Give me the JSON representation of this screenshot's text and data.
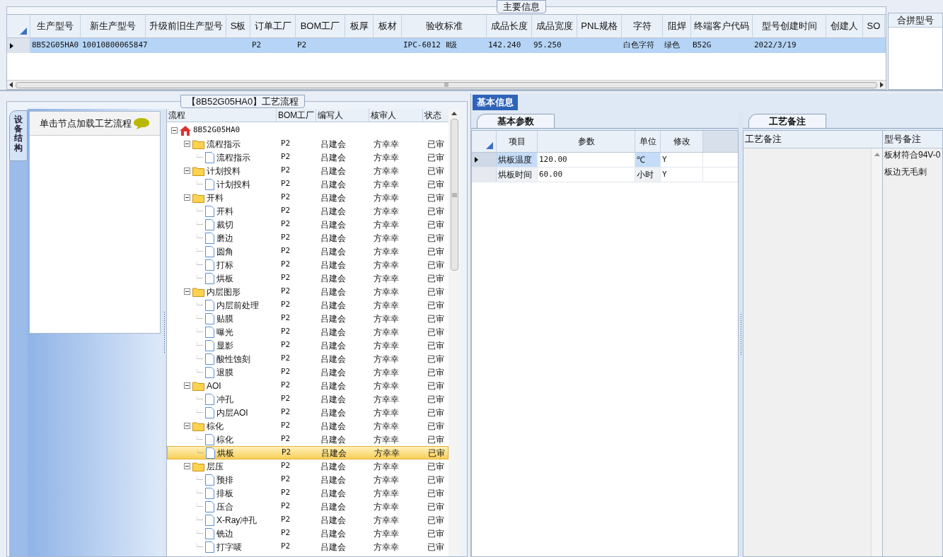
{
  "main_info": {
    "title": "主要信息",
    "columns": [
      "生产型号",
      "新生产型号",
      "升级前旧生产型号",
      "S板",
      "订单工厂",
      "BOM工厂",
      "板厚",
      "板材",
      "验收标准",
      "成品长度",
      "成品宽度",
      "PNL规格",
      "字符",
      "阻焊",
      "终端客户代码",
      "型号创建时间",
      "创建人",
      "SO"
    ],
    "rows": [
      {
        "selected": true,
        "cells": [
          "8B52G05HA0",
          "10010800065847",
          "",
          "",
          "P2",
          "P2",
          "",
          "",
          "IPC-6012 Ⅱ级",
          "142.240",
          "95.250",
          "",
          "白色字符",
          "绿色",
          "B52G",
          "2022/3/19",
          "",
          ""
        ]
      }
    ]
  },
  "merge_panel": {
    "title": "合拼型号"
  },
  "flow": {
    "title": "【8B52G05HA0】工艺流程",
    "side_tab": "设备结构",
    "hint": "单击节点加载工艺流程",
    "columns": [
      "流程",
      "BOM工厂",
      "编写人",
      "核审人",
      "状态"
    ],
    "tree": [
      {
        "label": "8B52G05HA0",
        "kind": "home",
        "expanded": true,
        "selected": false,
        "children": [
          {
            "label": "流程指示",
            "kind": "folder",
            "expanded": true,
            "selected": false,
            "cells": [
              "P2",
              "吕建会",
              "方幸幸",
              "已审"
            ],
            "children": [
              {
                "label": "流程指示",
                "kind": "step",
                "selected": false,
                "cells": [
                  "P2",
                  "吕建会",
                  "方幸幸",
                  "已审"
                ]
              }
            ]
          },
          {
            "label": "计划投料",
            "kind": "folder",
            "expanded": true,
            "selected": false,
            "cells": [
              "P2",
              "吕建会",
              "方幸幸",
              "已审"
            ],
            "children": [
              {
                "label": "计划投料",
                "kind": "step",
                "selected": false,
                "cells": [
                  "P2",
                  "吕建会",
                  "方幸幸",
                  "已审"
                ]
              }
            ]
          },
          {
            "label": "开料",
            "kind": "folder",
            "expanded": true,
            "selected": false,
            "cells": [
              "P2",
              "吕建会",
              "方幸幸",
              "已审"
            ],
            "children": [
              {
                "label": "开料",
                "kind": "step",
                "selected": false,
                "cells": [
                  "P2",
                  "吕建会",
                  "方幸幸",
                  "已审"
                ]
              },
              {
                "label": "裁切",
                "kind": "step",
                "selected": false,
                "cells": [
                  "P2",
                  "吕建会",
                  "方幸幸",
                  "已审"
                ]
              },
              {
                "label": "磨边",
                "kind": "step",
                "selected": false,
                "cells": [
                  "P2",
                  "吕建会",
                  "方幸幸",
                  "已审"
                ]
              },
              {
                "label": "圆角",
                "kind": "step",
                "selected": false,
                "cells": [
                  "P2",
                  "吕建会",
                  "方幸幸",
                  "已审"
                ]
              },
              {
                "label": "打标",
                "kind": "step",
                "selected": false,
                "cells": [
                  "P2",
                  "吕建会",
                  "方幸幸",
                  "已审"
                ]
              },
              {
                "label": "烘板",
                "kind": "step",
                "selected": false,
                "cells": [
                  "P2",
                  "吕建会",
                  "方幸幸",
                  "已审"
                ]
              }
            ]
          },
          {
            "label": "内层图形",
            "kind": "folder",
            "expanded": true,
            "selected": false,
            "cells": [
              "P2",
              "吕建会",
              "方幸幸",
              "已审"
            ],
            "children": [
              {
                "label": "内层前处理",
                "kind": "step",
                "selected": false,
                "cells": [
                  "P2",
                  "吕建会",
                  "方幸幸",
                  "已审"
                ]
              },
              {
                "label": "贴膜",
                "kind": "step",
                "selected": false,
                "cells": [
                  "P2",
                  "吕建会",
                  "方幸幸",
                  "已审"
                ]
              },
              {
                "label": "曝光",
                "kind": "step",
                "selected": false,
                "cells": [
                  "P2",
                  "吕建会",
                  "方幸幸",
                  "已审"
                ]
              },
              {
                "label": "显影",
                "kind": "step",
                "selected": false,
                "cells": [
                  "P2",
                  "吕建会",
                  "方幸幸",
                  "已审"
                ]
              },
              {
                "label": "酸性蚀刻",
                "kind": "step",
                "selected": false,
                "cells": [
                  "P2",
                  "吕建会",
                  "方幸幸",
                  "已审"
                ]
              },
              {
                "label": "退膜",
                "kind": "step",
                "selected": false,
                "cells": [
                  "P2",
                  "吕建会",
                  "方幸幸",
                  "已审"
                ]
              }
            ]
          },
          {
            "label": "AOI",
            "kind": "folder",
            "expanded": true,
            "selected": false,
            "cells": [
              "P2",
              "吕建会",
              "方幸幸",
              "已审"
            ],
            "children": [
              {
                "label": "冲孔",
                "kind": "step",
                "selected": false,
                "cells": [
                  "P2",
                  "吕建会",
                  "方幸幸",
                  "已审"
                ]
              },
              {
                "label": "内层AOI",
                "kind": "step",
                "selected": false,
                "cells": [
                  "P2",
                  "吕建会",
                  "方幸幸",
                  "已审"
                ]
              }
            ]
          },
          {
            "label": "棕化",
            "kind": "folder",
            "expanded": true,
            "selected": false,
            "cells": [
              "P2",
              "吕建会",
              "方幸幸",
              "已审"
            ],
            "children": [
              {
                "label": "棕化",
                "kind": "step",
                "selected": false,
                "cells": [
                  "P2",
                  "吕建会",
                  "方幸幸",
                  "已审"
                ]
              },
              {
                "label": "烘板",
                "kind": "step",
                "selected": true,
                "cells": [
                  "P2",
                  "吕建会",
                  "方幸幸",
                  "已审"
                ]
              }
            ]
          },
          {
            "label": "层压",
            "kind": "folder",
            "expanded": true,
            "selected": false,
            "cells": [
              "P2",
              "吕建会",
              "方幸幸",
              "已审"
            ],
            "children": [
              {
                "label": "预排",
                "kind": "step",
                "selected": false,
                "cells": [
                  "P2",
                  "吕建会",
                  "方幸幸",
                  "已审"
                ]
              },
              {
                "label": "排板",
                "kind": "step",
                "selected": false,
                "cells": [
                  "P2",
                  "吕建会",
                  "方幸幸",
                  "已审"
                ]
              },
              {
                "label": "压合",
                "kind": "step",
                "selected": false,
                "cells": [
                  "P2",
                  "吕建会",
                  "方幸幸",
                  "已审"
                ]
              },
              {
                "label": "X-Ray冲孔",
                "kind": "step",
                "selected": false,
                "cells": [
                  "P2",
                  "吕建会",
                  "方幸幸",
                  "已审"
                ]
              },
              {
                "label": "铣边",
                "kind": "step",
                "selected": false,
                "cells": [
                  "P2",
                  "吕建会",
                  "方幸幸",
                  "已审"
                ]
              },
              {
                "label": "打字唛",
                "kind": "step",
                "selected": false,
                "cells": [
                  "P2",
                  "吕建会",
                  "方幸幸",
                  "已审"
                ]
              }
            ]
          }
        ]
      }
    ]
  },
  "basic": {
    "tab": "基本信息",
    "params": {
      "tab": "基本参数",
      "columns": [
        "项目",
        "参数",
        "单位",
        "修改"
      ],
      "rows": [
        {
          "selected": true,
          "cells": [
            "烘板温度",
            "120.00",
            "℃",
            "Y"
          ]
        },
        {
          "selected": false,
          "cells": [
            "烘板时间",
            "60.00",
            "小时",
            "Y"
          ]
        }
      ]
    },
    "notes": {
      "tab": "工艺备注",
      "columns": [
        "工艺备注",
        "型号备注"
      ],
      "model_notes": [
        "板材符合94V-0",
        "板边无毛刺"
      ]
    }
  }
}
